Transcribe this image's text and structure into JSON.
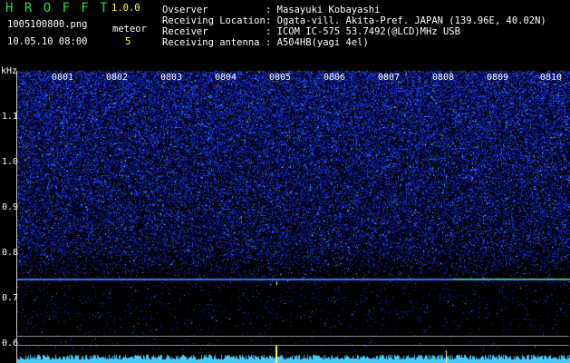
{
  "header": {
    "brand": "H R O F F T",
    "version": "1.0.0",
    "filename": "1005100800.png",
    "datetime": "10.05.10 08:00",
    "meteor_label": "meteor",
    "meteor_count": "5",
    "observer_label": "Ovserver",
    "observer_value": ": Masayuki Kobayashi",
    "location_label": "Receiving Location",
    "location_value": ": Ogata-vill. Akita-Pref. JAPAN (139.96E, 40.02N)",
    "receiver_label": "Receiver",
    "receiver_value": ": ICOM IC-575 53.7492(@LCD)MHz USB",
    "antenna_label": "Receiving antenna",
    "antenna_value": ": A504HB(yagi 4el)"
  },
  "colors": {
    "brand": "#22e046",
    "accent_yellow": "#ffff55",
    "signal_cyan": "#3fd0ff",
    "noise_blue": "#2040ff"
  },
  "axis": {
    "unit": "kHz",
    "y_ticks": [
      {
        "label": "1.1",
        "value": 1.1
      },
      {
        "label": "1.0",
        "value": 1.0
      },
      {
        "label": "0.9",
        "value": 0.9
      },
      {
        "label": "0.8",
        "value": 0.8
      },
      {
        "label": "0.7",
        "value": 0.7
      },
      {
        "label": "0.6",
        "value": 0.6
      }
    ],
    "time_ticks": [
      "0801",
      "0802",
      "0803",
      "0804",
      "0805",
      "0806",
      "0807",
      "0808",
      "0809",
      "0810"
    ]
  }
}
